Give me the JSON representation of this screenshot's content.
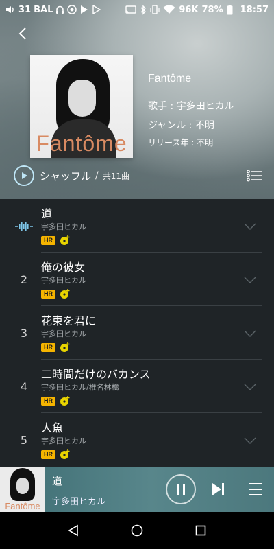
{
  "status_bar": {
    "volume_level": "31",
    "bal_label": "BAL",
    "network_speed": "96K",
    "battery": "78%",
    "time": "18:57"
  },
  "album": {
    "cover_text": "Fantôme",
    "title": "Fantôme",
    "artist_line": "歌手 : 宇多田ヒカル",
    "genre_line": "ジャンル : 不明",
    "year_line": "リリース年 : 不明"
  },
  "shuffle": {
    "label": "シャッフル",
    "separator": "/",
    "count": "共11曲"
  },
  "tracks": [
    {
      "number": "",
      "playing": true,
      "title": "道",
      "artist": "宇多田ヒカル",
      "badge": "HR"
    },
    {
      "number": "2",
      "playing": false,
      "title": "俺の彼女",
      "artist": "宇多田ヒカル",
      "badge": "HR"
    },
    {
      "number": "3",
      "playing": false,
      "title": "花束を君に",
      "artist": "宇多田ヒカル",
      "badge": "HR"
    },
    {
      "number": "4",
      "playing": false,
      "title": "二時間だけのバカンス",
      "artist": "宇多田ヒカル/椎名林檎",
      "badge": "HR"
    },
    {
      "number": "5",
      "playing": false,
      "title": "人魚",
      "artist": "宇多田ヒカル",
      "badge": "HR"
    }
  ],
  "player": {
    "thumb_text": "Fantôme",
    "title": "道",
    "artist": "宇多田ヒカル"
  },
  "colors": {
    "accent": "#bfe6f6",
    "hr_badge": "#f5b400",
    "disc_badge": "#e8d400",
    "list_bg": "#1f2427",
    "player_bg": "#4f7d82"
  }
}
